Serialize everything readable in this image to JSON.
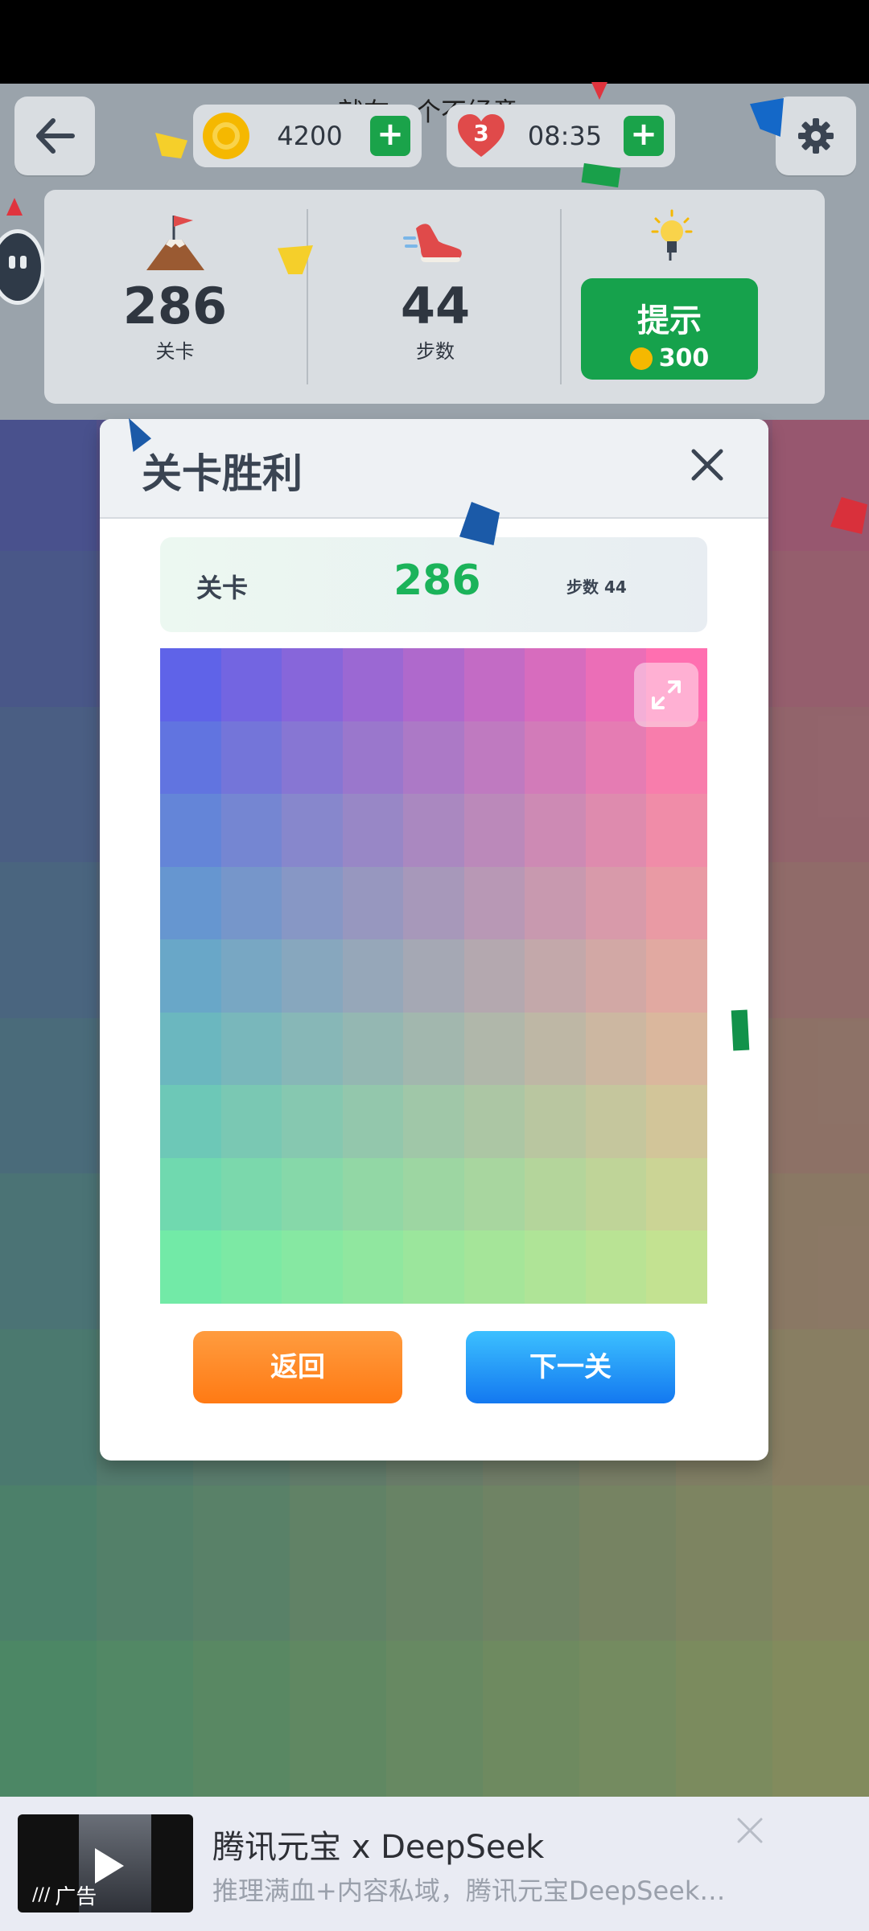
{
  "header": {
    "marquee_text": "就在一个不经意",
    "coins": "4200",
    "lives": "3",
    "timer": "08:35"
  },
  "stats": {
    "level_value": "286",
    "level_label": "关卡",
    "steps_value": "44",
    "steps_label": "步数",
    "hint_label": "提示",
    "hint_cost": "300"
  },
  "modal": {
    "title": "关卡胜利",
    "banner_label": "关卡",
    "banner_level": "286",
    "banner_steps": "步数 44",
    "back_label": "返回",
    "next_label": "下一关"
  },
  "ad": {
    "title": "腾讯元宝 x DeepSeek",
    "subtitle": "推理满血+内容私域，腾讯元宝DeepSeek…",
    "tag": "广告"
  },
  "colors": {
    "green": "#16a24c",
    "orange": "#ff7a14",
    "blue": "#1378f0",
    "level_green": "#1bb35a"
  },
  "result_gradient": {
    "top_left": "#5f63e8",
    "top_right": "#ff6fb0",
    "bottom_left": "#72eaa7",
    "bottom_right": "#c3e291"
  },
  "background_gradient": {
    "top_left": "#4b3fae",
    "top_right": "#c0497d",
    "bottom_left": "#4f9d69",
    "bottom_right": "#9aa35e"
  }
}
